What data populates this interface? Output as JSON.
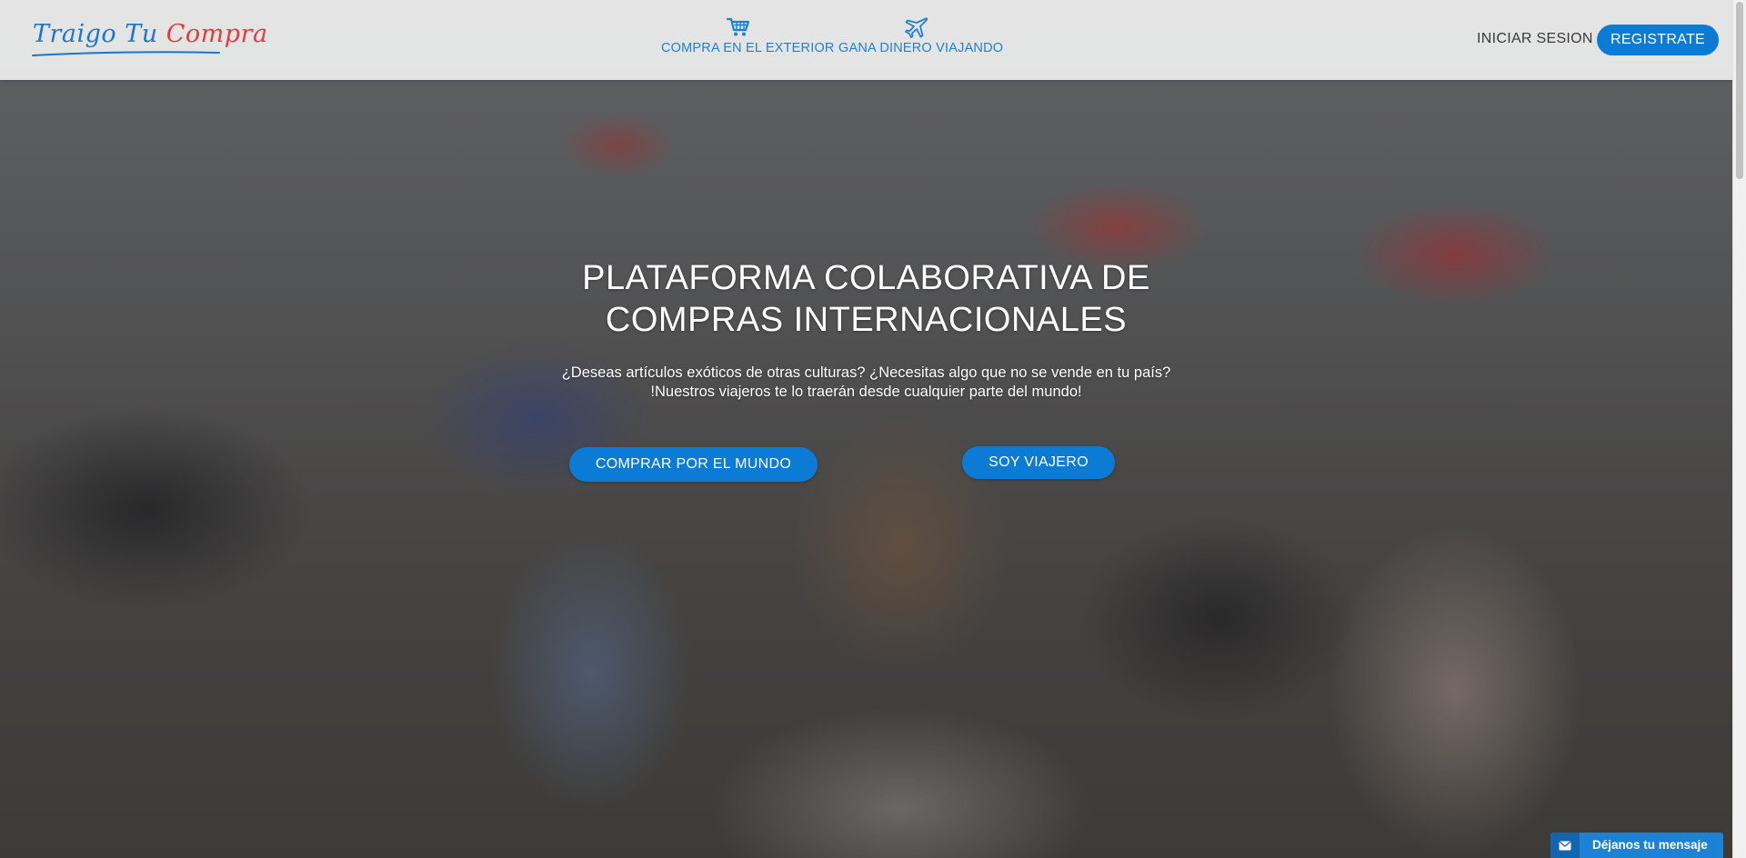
{
  "brand": {
    "logo_part1": "Traigo Tu ",
    "logo_part2": "Compra",
    "color_blue": "#1b77c9",
    "color_red": "#e23b3b"
  },
  "nav": {
    "items": [
      {
        "label": "COMPRA EN EL EXTERIOR",
        "icon": "shopping-cart-icon"
      },
      {
        "label": "GANA DINERO VIAJANDO",
        "icon": "airplane-icon"
      }
    ]
  },
  "auth": {
    "login_label": "INICIAR SESION",
    "register_label": "REGISTRATE"
  },
  "hero": {
    "title_line1": "PLATAFORMA COLABORATIVA DE",
    "title_line2": "COMPRAS INTERNACIONALES",
    "subtitle_line1": "¿Deseas artículos exóticos de otras culturas? ¿Necesitas algo que no se vende en tu país?",
    "subtitle_line2": "!Nuestros viajeros te lo traerán desde cualquier parte del mundo!",
    "cta_buy": "COMPRAR POR EL MUNDO",
    "cta_travel": "SOY VIAJERO"
  },
  "chat_widget": {
    "label": "Déjanos tu mensaje",
    "icon": "envelope-icon"
  },
  "colors": {
    "accent": "#0b7bd6",
    "nav_text": "#1b82d6",
    "header_bg": "#ececec"
  }
}
